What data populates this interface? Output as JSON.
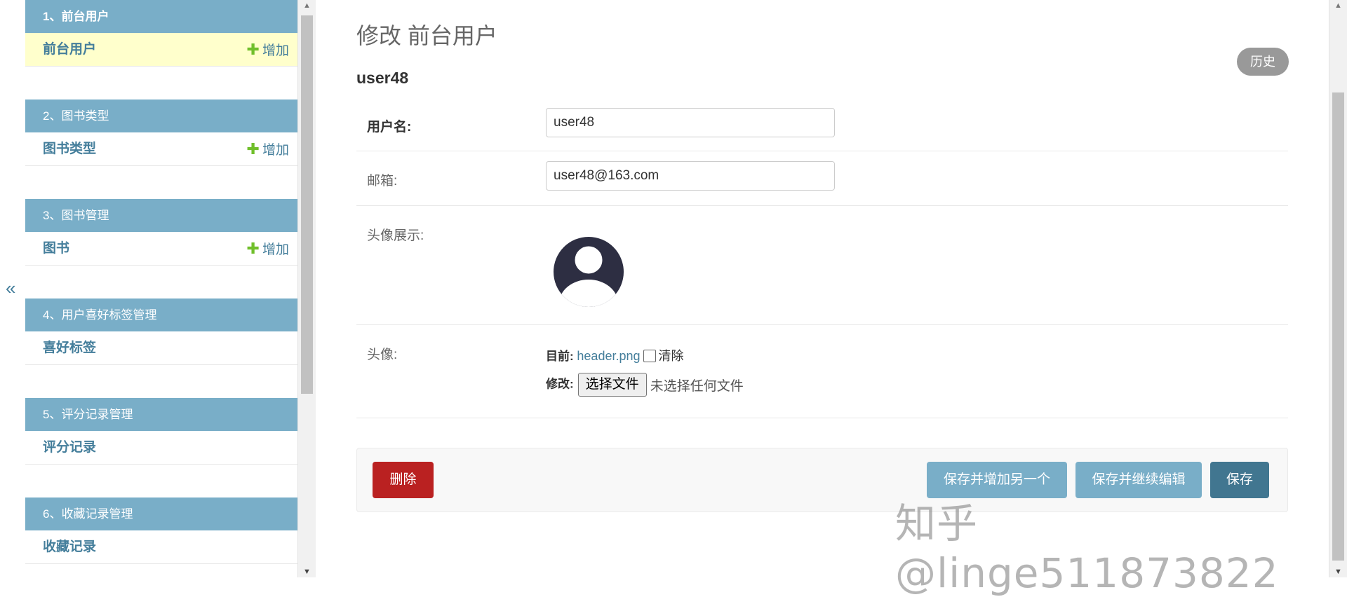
{
  "nav_toggle": {
    "icon": "chevron-double-left-icon",
    "label": "«"
  },
  "sidebar": {
    "apps": [
      {
        "caption": "1、前台用户",
        "models": [
          {
            "name": "前台用户",
            "add_label": "增加"
          }
        ]
      },
      {
        "caption": "2、图书类型",
        "models": [
          {
            "name": "图书类型",
            "add_label": "增加"
          }
        ]
      },
      {
        "caption": "3、图书管理",
        "models": [
          {
            "name": "图书",
            "add_label": "增加"
          }
        ]
      },
      {
        "caption": "4、用户喜好标签管理",
        "models": [
          {
            "name": "喜好标签"
          }
        ]
      },
      {
        "caption": "5、评分记录管理",
        "models": [
          {
            "name": "评分记录"
          }
        ]
      },
      {
        "caption": "6、收藏记录管理",
        "models": [
          {
            "name": "收藏记录"
          }
        ]
      }
    ],
    "add_icon": "plus-icon",
    "plus_glyph": "✚"
  },
  "main": {
    "title": "修改 前台用户",
    "history_label": "历史",
    "object_name": "user48",
    "fields": {
      "username": {
        "label": "用户名:",
        "value": "user48"
      },
      "email": {
        "label": "邮箱:",
        "value": "user48@163.com"
      },
      "avatar_display": {
        "label": "头像展示:",
        "icon": "user-avatar-icon"
      },
      "avatar": {
        "label": "头像:",
        "current_label": "目前:",
        "current_file": "header.png",
        "clear_label": "清除",
        "change_label": "修改:",
        "choose_button": "选择文件",
        "no_file_text": "未选择任何文件"
      }
    },
    "actions": {
      "delete": "删除",
      "save_add_another": "保存并增加另一个",
      "save_continue": "保存并继续编辑",
      "save": "保存"
    }
  },
  "watermark": "知乎 @linge511873822",
  "colors": {
    "header_blue": "#79aec8",
    "link_blue": "#447e9b",
    "active_row": "#ffffcc",
    "add_green": "#70bf2b",
    "delete_red": "#ba2121",
    "save_dark": "#417690"
  }
}
